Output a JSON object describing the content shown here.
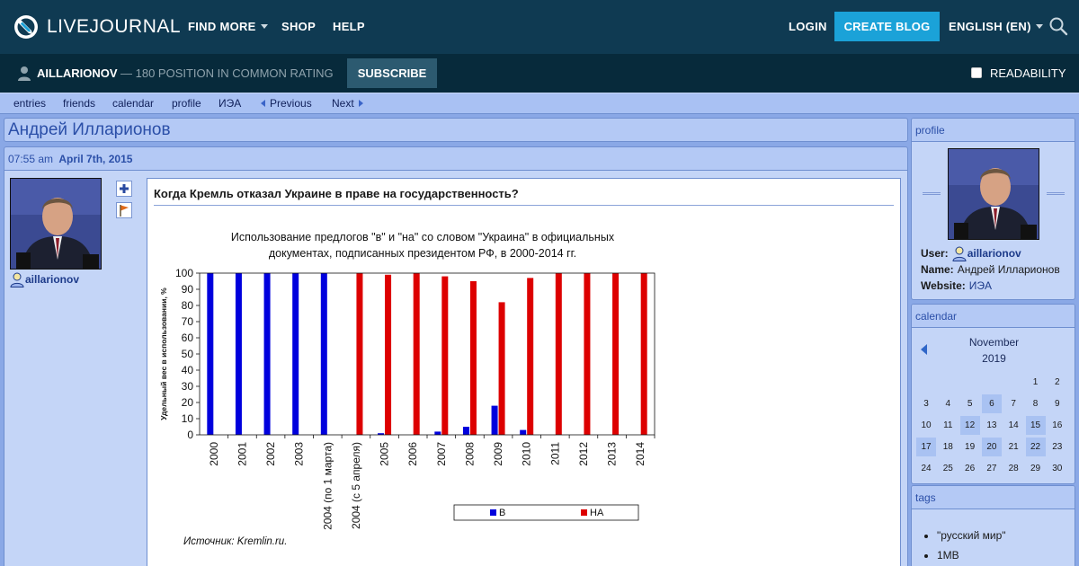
{
  "header": {
    "logo_text": "LIVEJOURNAL",
    "nav": [
      {
        "label": "FIND MORE",
        "has_caret": true
      },
      {
        "label": "SHOP",
        "has_caret": false
      },
      {
        "label": "HELP",
        "has_caret": false
      }
    ],
    "login": "LOGIN",
    "create_blog": "CREATE BLOG",
    "language": "ENGLISH (EN)"
  },
  "subbar": {
    "username": "AILLARIONOV",
    "rating": "— 180 POSITION IN COMMON RATING",
    "subscribe": "SUBSCRIBE",
    "readability": "READABILITY"
  },
  "lj_nav": {
    "entries": "entries",
    "friends": "friends",
    "calendar": "calendar",
    "profile": "profile",
    "iea": "ИЭА",
    "previous": "Previous",
    "next": "Next"
  },
  "blog": {
    "title": "Андрей Илларионов"
  },
  "entry": {
    "time": "07:55 am",
    "date": "April 7th, 2015",
    "author": "aillarionov",
    "subject": "Когда Кремль отказал Украине в праве на государственность?"
  },
  "chart_data": {
    "type": "bar",
    "title": "Использование предлогов \"в\" и \"на\" со словом \"Украина\" в официальных документах, подписанных президентом РФ, в 2000-2014 гг.",
    "title_lines": [
      "Использование предлогов \"в\" и \"на\" со словом \"Украина\" в официальных",
      "документах, подписанных президентом РФ, в 2000-2014 гг."
    ],
    "ylabel": "Удельный вес в использовании, %",
    "ylim": [
      0,
      100
    ],
    "yticks": [
      0,
      10,
      20,
      30,
      40,
      50,
      60,
      70,
      80,
      90,
      100
    ],
    "categories": [
      "2000",
      "2001",
      "2002",
      "2003",
      "2004 (по 1 марта)",
      "2004 (с 5 апреля)",
      "2005",
      "2006",
      "2007",
      "2008",
      "2009",
      "2010",
      "2011",
      "2012",
      "2013",
      "2014"
    ],
    "series": [
      {
        "name": "В",
        "color": "#0000dd",
        "values": [
          100,
          100,
          100,
          100,
          100,
          0,
          1,
          0,
          2,
          5,
          18,
          3,
          0,
          0,
          0,
          0
        ]
      },
      {
        "name": "НА",
        "color": "#dd0000",
        "values": [
          0,
          0,
          0,
          0,
          0,
          100,
          99,
          100,
          98,
          95,
          82,
          97,
          100,
          100,
          100,
          100
        ]
      }
    ],
    "legend_position": "bottom-right",
    "source": "Источник: Kremlin.ru."
  },
  "sidebar": {
    "profile": {
      "head": "profile",
      "user_label": "User:",
      "user_value": "aillarionov",
      "name_label": "Name:",
      "name_value": "Андрей Илларионов",
      "website_label": "Website:",
      "website_value": "ИЭА"
    },
    "calendar": {
      "head": "calendar",
      "month": "November",
      "year": "2019",
      "weeks": [
        [
          "",
          "",
          "",
          "",
          "",
          "1",
          "2"
        ],
        [
          "3",
          "4",
          "5",
          "6",
          "7",
          "8",
          "9"
        ],
        [
          "10",
          "11",
          "12",
          "13",
          "14",
          "15",
          "16"
        ],
        [
          "17",
          "18",
          "19",
          "20",
          "21",
          "22",
          "23"
        ],
        [
          "24",
          "25",
          "26",
          "27",
          "28",
          "29",
          "30"
        ]
      ],
      "highlighted": [
        "6",
        "12",
        "15",
        "17",
        "20",
        "22"
      ]
    },
    "tags": {
      "head": "tags",
      "items": [
        "\"русский мир\"",
        "1MB"
      ]
    }
  }
}
